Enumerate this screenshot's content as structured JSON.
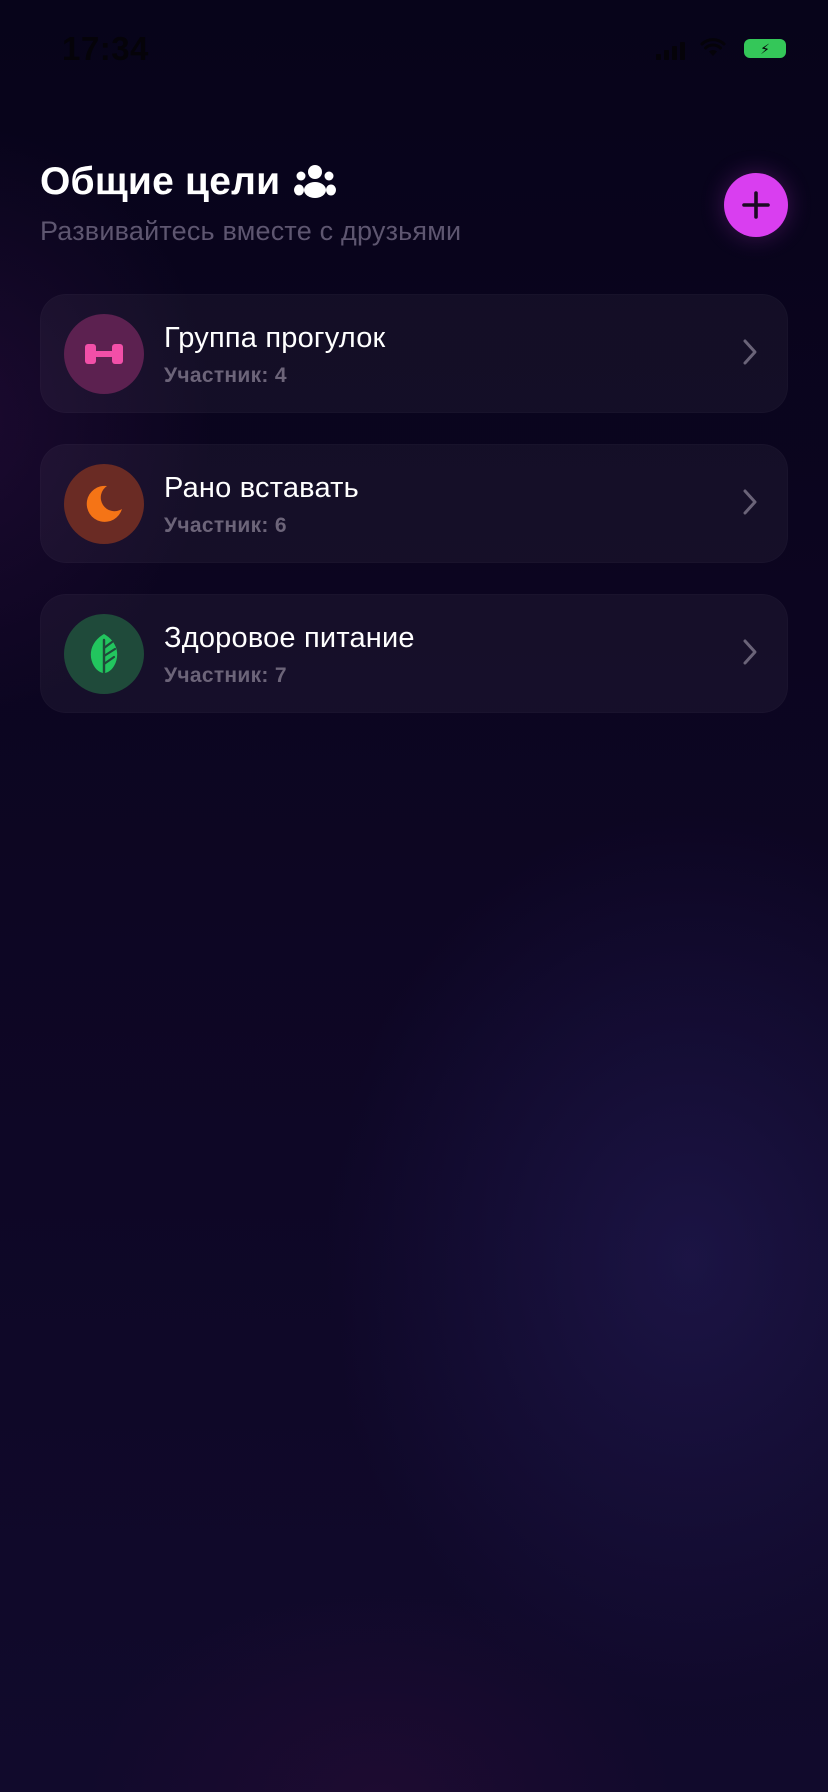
{
  "status_bar": {
    "time": "17:34"
  },
  "header": {
    "title": "Общие цели",
    "title_icon": "group-people-icon",
    "subtitle": "Развивайтесь вместе с друзьями",
    "add_button_icon": "plus-icon"
  },
  "goals": [
    {
      "title": "Группа прогулок",
      "members": "Участник: 4",
      "icon": "dumbbell-icon",
      "icon_color": "#f24fa8",
      "icon_bg": "#5c2150"
    },
    {
      "title": "Рано вставать",
      "members": "Участник: 6",
      "icon": "moon-icon",
      "icon_color": "#f57416",
      "icon_bg": "#6a2b24"
    },
    {
      "title": "Здоровое питание",
      "members": "Участник: 7",
      "icon": "leaf-icon",
      "icon_color": "#22c55e",
      "icon_bg": "#1f4a3a"
    }
  ],
  "colors": {
    "accent": "#d93ef0",
    "battery": "#34c759"
  }
}
